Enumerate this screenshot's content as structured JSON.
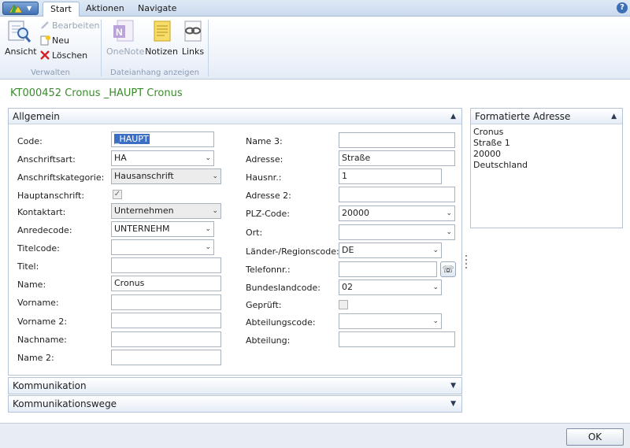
{
  "ribbon": {
    "tabs": [
      "Start",
      "Aktionen",
      "Navigate"
    ],
    "groups": {
      "verwalten": {
        "label": "Verwalten",
        "ansicht": "Ansicht",
        "bearbeiten": "Bearbeiten",
        "neu": "Neu",
        "loeschen": "Löschen"
      },
      "dateianhang": {
        "label": "Dateianhang anzeigen",
        "onenote": "OneNote",
        "notizen": "Notizen",
        "links": "Links"
      }
    },
    "help": "?"
  },
  "page": {
    "title": "KT000452 Cronus _HAUPT Cronus"
  },
  "allgemein": {
    "header": "Allgemein",
    "left": {
      "code": {
        "label": "Code:",
        "value": "_HAUPT"
      },
      "anschriftsart": {
        "label": "Anschriftsart:",
        "value": "HA"
      },
      "anschriftskategorie": {
        "label": "Anschriftskategorie:",
        "value": "Hausanschrift"
      },
      "hauptanschrift": {
        "label": "Hauptanschrift:",
        "checked": "✓"
      },
      "kontaktart": {
        "label": "Kontaktart:",
        "value": "Unternehmen"
      },
      "anredecode": {
        "label": "Anredecode:",
        "value": "UNTERNEHM"
      },
      "titelcode": {
        "label": "Titelcode:",
        "value": ""
      },
      "titel": {
        "label": "Titel:",
        "value": ""
      },
      "name": {
        "label": "Name:",
        "value": "Cronus"
      },
      "vorname": {
        "label": "Vorname:",
        "value": ""
      },
      "vorname2": {
        "label": "Vorname 2:",
        "value": ""
      },
      "nachname": {
        "label": "Nachname:",
        "value": ""
      },
      "name2": {
        "label": "Name 2:",
        "value": ""
      }
    },
    "right": {
      "name3": {
        "label": "Name 3:",
        "value": ""
      },
      "adresse": {
        "label": "Adresse:",
        "value": "Straße"
      },
      "hausnr": {
        "label": "Hausnr.:",
        "value": "1"
      },
      "adresse2": {
        "label": "Adresse 2:",
        "value": ""
      },
      "plz": {
        "label": "PLZ-Code:",
        "value": "20000"
      },
      "ort": {
        "label": "Ort:",
        "value": ""
      },
      "land": {
        "label": "Länder-/Regionscode:",
        "value": "DE"
      },
      "telefon": {
        "label": "Telefonnr.:",
        "value": ""
      },
      "bundesland": {
        "label": "Bundeslandcode:",
        "value": "02"
      },
      "geprueft": {
        "label": "Geprüft:"
      },
      "abteilungscode": {
        "label": "Abteilungscode:",
        "value": ""
      },
      "abteilung": {
        "label": "Abteilung:",
        "value": ""
      }
    }
  },
  "sections": {
    "kommunikation": "Kommunikation",
    "kommunikationswege": "Kommunikationswege"
  },
  "factbox": {
    "header": "Formatierte Adresse",
    "lines": [
      "Cronus",
      "Straße 1",
      "20000",
      "Deutschland"
    ]
  },
  "footer": {
    "ok": "OK"
  },
  "icons": {
    "dropdown": "⌄",
    "collapse": "▲",
    "expand": "▼",
    "phone": "☏"
  }
}
